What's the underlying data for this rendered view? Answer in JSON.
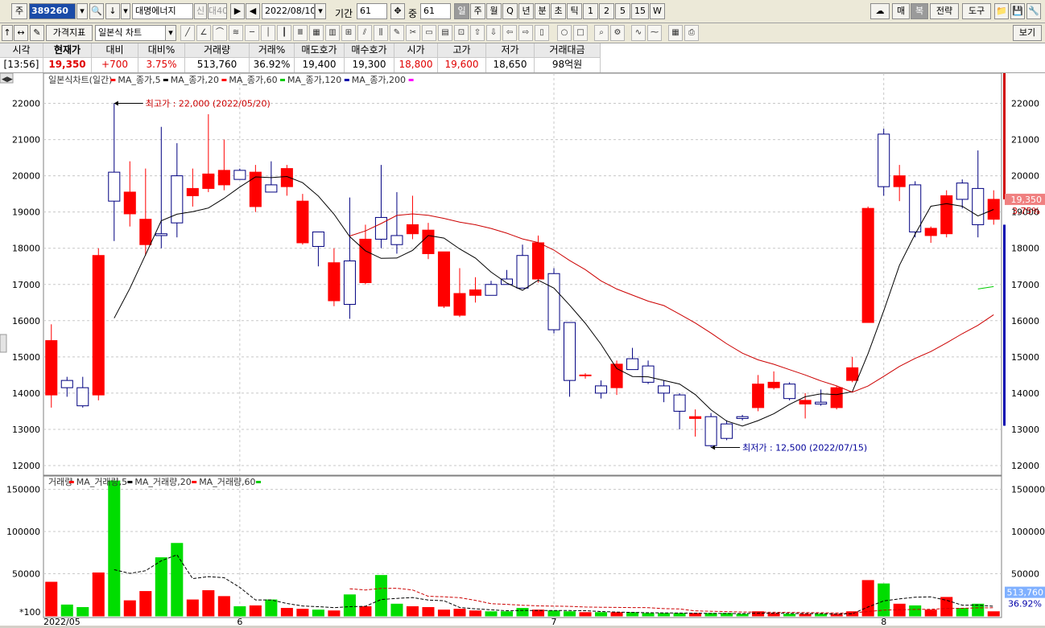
{
  "toolbar": {
    "market_label": "주",
    "stock_code": "389260",
    "stock_name": "대명에너지",
    "flag1": "신",
    "flag2": "대40",
    "date": "2022/08/10",
    "period_label": "기간",
    "period_value": "61",
    "overlap_label": "중",
    "overlap_value": "61",
    "intervals": [
      "일",
      "주",
      "월",
      "Q",
      "년",
      "분",
      "초",
      "틱",
      "1",
      "2",
      "5",
      "15",
      "W"
    ],
    "selected_interval": "일",
    "right_buttons": [
      "매",
      "복",
      "전략",
      "도구"
    ]
  },
  "toolbar2": {
    "indicator_button": "가격지표",
    "chart_type": "일본식 차트",
    "view_button": "보기"
  },
  "quote": {
    "headers": [
      "시각",
      "현재가",
      "대비",
      "대비%",
      "거래량",
      "거래%",
      "매도호가",
      "매수호가",
      "시가",
      "고가",
      "저가",
      "거래대금"
    ],
    "values": [
      "[13:56]",
      "19,350",
      "+700",
      "3.75%",
      "513,760",
      "36.92%",
      "19,400",
      "19,300",
      "18,800",
      "19,600",
      "18,650",
      "98억원"
    ]
  },
  "legend": {
    "price_title": "일본식차트(일간)",
    "price_mas": [
      {
        "name": "MA_종가,5",
        "color": "#ff0000"
      },
      {
        "name": "MA_종가,20",
        "color": "#000000"
      },
      {
        "name": "MA_종가,60",
        "color": "#ff0000"
      },
      {
        "name": "MA_종가,120",
        "color": "#00cc00"
      },
      {
        "name": "MA_종가,200",
        "color": "#0000aa"
      }
    ],
    "price_end_color": "#ff00ff",
    "volume_title": "거래량",
    "volume_mas": [
      {
        "name": "MA_거래량,5",
        "color": "#ff0000"
      },
      {
        "name": "MA_거래량,20",
        "color": "#000000"
      },
      {
        "name": "MA_거래량,60",
        "color": "#ff0000"
      }
    ],
    "volume_end_color": "#00cc00"
  },
  "chart_data": {
    "type": "candlestick",
    "price_axis": {
      "min": 12000,
      "max": 22000,
      "ticks": [
        12000,
        13000,
        14000,
        15000,
        16000,
        17000,
        18000,
        19000,
        20000,
        21000,
        22000
      ],
      "view_range": [
        11800,
        22700
      ]
    },
    "volume_axis": {
      "min": 0,
      "max": 150000,
      "ticks": [
        50000,
        100000,
        150000
      ],
      "view_range": [
        0,
        162000
      ],
      "unit_label": "*100"
    },
    "x_labels": [
      {
        "index": 0,
        "text": "2022/05"
      },
      {
        "index": 12,
        "text": "6"
      },
      {
        "index": 32,
        "text": "7"
      },
      {
        "index": 53,
        "text": "8"
      }
    ],
    "candles": [
      {
        "o": 13950,
        "h": 15900,
        "l": 13600,
        "c": 15450,
        "v": 40000
      },
      {
        "o": 14350,
        "h": 14450,
        "l": 13900,
        "c": 14150,
        "v": 13000
      },
      {
        "o": 14150,
        "h": 14450,
        "l": 13600,
        "c": 13650,
        "v": 10000
      },
      {
        "o": 13950,
        "h": 18000,
        "l": 13800,
        "c": 17800,
        "v": 51000
      },
      {
        "o": 20100,
        "h": 22000,
        "l": 18200,
        "c": 19300,
        "v": 160000
      },
      {
        "o": 18950,
        "h": 20400,
        "l": 18600,
        "c": 19550,
        "v": 18000
      },
      {
        "o": 18100,
        "h": 20200,
        "l": 17800,
        "c": 18800,
        "v": 29000
      },
      {
        "o": 18400,
        "h": 21350,
        "l": 18000,
        "c": 18350,
        "v": 69000
      },
      {
        "o": 20000,
        "h": 20900,
        "l": 18300,
        "c": 18700,
        "v": 86000
      },
      {
        "o": 19450,
        "h": 20200,
        "l": 19150,
        "c": 19650,
        "v": 19000
      },
      {
        "o": 19650,
        "h": 21700,
        "l": 19550,
        "c": 20050,
        "v": 30000
      },
      {
        "o": 19750,
        "h": 21000,
        "l": 19600,
        "c": 20150,
        "v": 23000
      },
      {
        "o": 20150,
        "h": 20200,
        "l": 19900,
        "c": 19900,
        "v": 11000
      },
      {
        "o": 19150,
        "h": 20300,
        "l": 19000,
        "c": 20100,
        "v": 12000
      },
      {
        "o": 19750,
        "h": 20400,
        "l": 19550,
        "c": 19550,
        "v": 19000
      },
      {
        "o": 19700,
        "h": 20300,
        "l": 19450,
        "c": 20200,
        "v": 9000
      },
      {
        "o": 18150,
        "h": 19500,
        "l": 18100,
        "c": 19300,
        "v": 8000
      },
      {
        "o": 18450,
        "h": 18450,
        "l": 17500,
        "c": 18050,
        "v": 7000
      },
      {
        "o": 16550,
        "h": 18000,
        "l": 16400,
        "c": 17600,
        "v": 6000
      },
      {
        "o": 17650,
        "h": 19400,
        "l": 16050,
        "c": 16450,
        "v": 25000
      },
      {
        "o": 17050,
        "h": 18650,
        "l": 17000,
        "c": 18250,
        "v": 11000
      },
      {
        "o": 18850,
        "h": 20300,
        "l": 18000,
        "c": 18250,
        "v": 48000
      },
      {
        "o": 18350,
        "h": 19550,
        "l": 17850,
        "c": 18100,
        "v": 14000
      },
      {
        "o": 18400,
        "h": 19450,
        "l": 18250,
        "c": 18650,
        "v": 11000
      },
      {
        "o": 17850,
        "h": 18700,
        "l": 17700,
        "c": 18500,
        "v": 10000
      },
      {
        "o": 16400,
        "h": 17900,
        "l": 16350,
        "c": 17900,
        "v": 7000
      },
      {
        "o": 16150,
        "h": 17450,
        "l": 16100,
        "c": 16750,
        "v": 8000
      },
      {
        "o": 16700,
        "h": 17200,
        "l": 16500,
        "c": 16850,
        "v": 6000
      },
      {
        "o": 17000,
        "h": 17100,
        "l": 16700,
        "c": 16700,
        "v": 5000
      },
      {
        "o": 17150,
        "h": 17400,
        "l": 17000,
        "c": 17000,
        "v": 5000
      },
      {
        "o": 17800,
        "h": 18100,
        "l": 16900,
        "c": 16900,
        "v": 9000
      },
      {
        "o": 17150,
        "h": 18350,
        "l": 17050,
        "c": 18150,
        "v": 7000
      },
      {
        "o": 17300,
        "h": 17450,
        "l": 15650,
        "c": 15750,
        "v": 6000
      },
      {
        "o": 15950,
        "h": 15950,
        "l": 13900,
        "c": 14350,
        "v": 5000
      },
      {
        "o": 14500,
        "h": 14550,
        "l": 14400,
        "c": 14500,
        "v": 4000
      },
      {
        "o": 14200,
        "h": 14350,
        "l": 13850,
        "c": 14000,
        "v": 4000
      },
      {
        "o": 14150,
        "h": 14900,
        "l": 13950,
        "c": 14800,
        "v": 4000
      },
      {
        "o": 14950,
        "h": 15250,
        "l": 14700,
        "c": 14650,
        "v": 4000
      },
      {
        "o": 14750,
        "h": 14900,
        "l": 14250,
        "c": 14300,
        "v": 3000
      },
      {
        "o": 14200,
        "h": 14350,
        "l": 13750,
        "c": 14000,
        "v": 3000
      },
      {
        "o": 13950,
        "h": 14000,
        "l": 13000,
        "c": 13500,
        "v": 3000
      },
      {
        "o": 13300,
        "h": 13550,
        "l": 12800,
        "c": 13350,
        "v": 3000
      },
      {
        "o": 13350,
        "h": 13450,
        "l": 12500,
        "c": 12550,
        "v": 3000
      },
      {
        "o": 13150,
        "h": 13250,
        "l": 12700,
        "c": 12750,
        "v": 3000
      },
      {
        "o": 13350,
        "h": 13400,
        "l": 13250,
        "c": 13300,
        "v": 2000
      },
      {
        "o": 13600,
        "h": 14500,
        "l": 13500,
        "c": 14250,
        "v": 5000
      },
      {
        "o": 14150,
        "h": 14600,
        "l": 14100,
        "c": 14300,
        "v": 3000
      },
      {
        "o": 14250,
        "h": 14300,
        "l": 13800,
        "c": 13850,
        "v": 2000
      },
      {
        "o": 13700,
        "h": 14000,
        "l": 13300,
        "c": 13800,
        "v": 2000
      },
      {
        "o": 13750,
        "h": 14100,
        "l": 13650,
        "c": 13700,
        "v": 2000
      },
      {
        "o": 13600,
        "h": 14200,
        "l": 13550,
        "c": 14150,
        "v": 2000
      },
      {
        "o": 14350,
        "h": 15000,
        "l": 14300,
        "c": 14700,
        "v": 5000
      },
      {
        "o": 15950,
        "h": 19150,
        "l": 15950,
        "c": 19100,
        "v": 42000
      },
      {
        "o": 21150,
        "h": 21300,
        "l": 19450,
        "c": 19700,
        "v": 38000
      },
      {
        "o": 19700,
        "h": 20300,
        "l": 19300,
        "c": 20000,
        "v": 14000
      },
      {
        "o": 19750,
        "h": 19850,
        "l": 18300,
        "c": 18450,
        "v": 12000
      },
      {
        "o": 18350,
        "h": 18600,
        "l": 18150,
        "c": 18550,
        "v": 7000
      },
      {
        "o": 18400,
        "h": 19600,
        "l": 18300,
        "c": 19450,
        "v": 22000
      },
      {
        "o": 19800,
        "h": 19900,
        "l": 19100,
        "c": 19350,
        "v": 9000
      },
      {
        "o": 19650,
        "h": 20700,
        "l": 18300,
        "c": 18650,
        "v": 14000
      },
      {
        "o": 18800,
        "h": 19600,
        "l": 18650,
        "c": 19350,
        "v": 5000
      }
    ],
    "annotations": [
      {
        "label": "최고가 : 22,000 (2022/05/20)",
        "index": 4,
        "price": 22000
      },
      {
        "label": "최저가 : 12,500 (2022/07/15)",
        "index": 42,
        "price": 12500
      }
    ],
    "current_price_label": "19,350",
    "current_change_label": "3.75%",
    "current_volume_label": "513,760",
    "current_volume_pct_label": "36.92%"
  }
}
